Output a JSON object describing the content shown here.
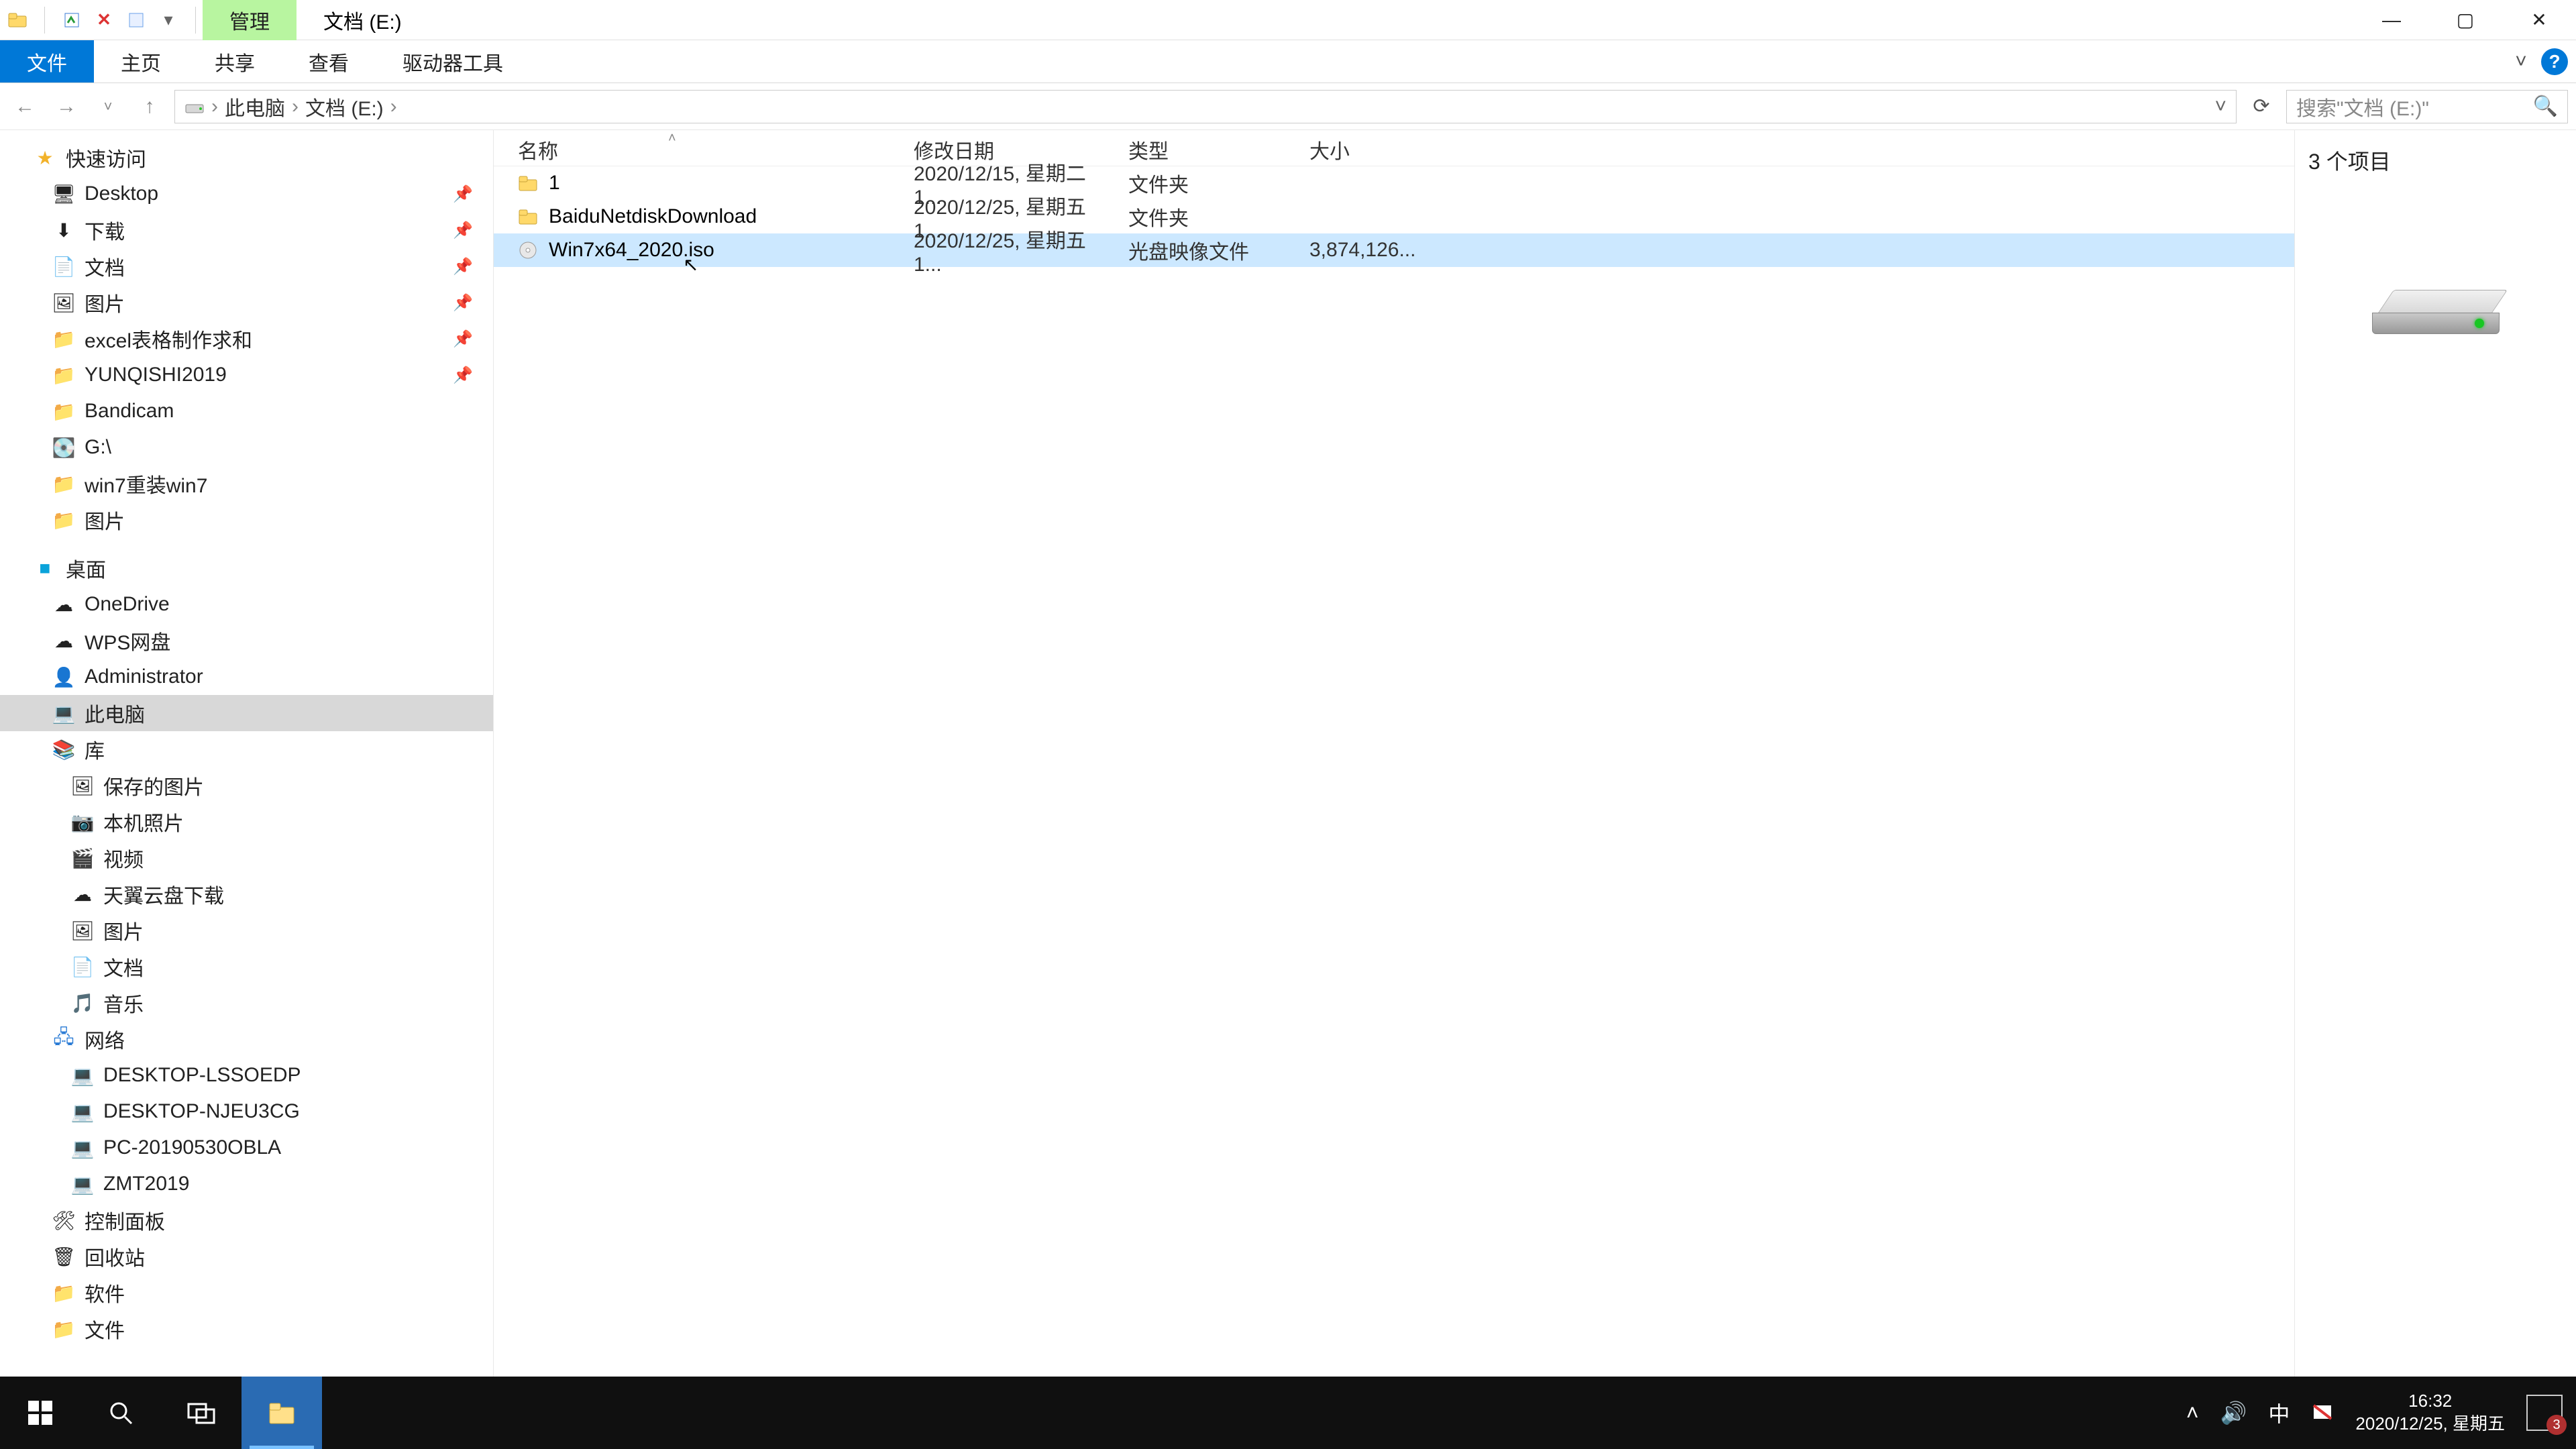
{
  "title": {
    "contextual_tab": "管理",
    "location_label": "文档 (E:)"
  },
  "window_controls": {
    "minimize": "—",
    "maximize": "▢",
    "close": "✕"
  },
  "ribbon": {
    "file": "文件",
    "home": "主页",
    "share": "共享",
    "view": "查看",
    "drive_tools": "驱动器工具"
  },
  "nav": {
    "back": "←",
    "forward": "→",
    "recent": "˅",
    "up": "↑",
    "crumbs": [
      "此电脑",
      "文档 (E:)"
    ],
    "search_placeholder": "搜索\"文档 (E:)\""
  },
  "tree": {
    "quick_access": "快速访问",
    "quick_items": [
      {
        "icon": "🖥",
        "label": "Desktop",
        "pinned": true
      },
      {
        "icon": "⬇",
        "label": "下载",
        "pinned": true
      },
      {
        "icon": "📄",
        "label": "文档",
        "pinned": true
      },
      {
        "icon": "🖼",
        "label": "图片",
        "pinned": true
      },
      {
        "icon": "📁",
        "label": "excel表格制作求和",
        "pinned": true
      },
      {
        "icon": "📁",
        "label": "YUNQISHI2019",
        "pinned": true
      },
      {
        "icon": "📁",
        "label": "Bandicam",
        "pinned": false
      },
      {
        "icon": "💽",
        "label": "G:\\",
        "pinned": false
      },
      {
        "icon": "📁",
        "label": "win7重装win7",
        "pinned": false
      },
      {
        "icon": "📁",
        "label": "图片",
        "pinned": false
      }
    ],
    "desktop": "桌面",
    "desktop_items": [
      {
        "icon": "☁",
        "label": "OneDrive"
      },
      {
        "icon": "☁",
        "label": "WPS网盘"
      },
      {
        "icon": "👤",
        "label": "Administrator"
      },
      {
        "icon": "💻",
        "label": "此电脑",
        "selected": true
      },
      {
        "icon": "📚",
        "label": "库"
      }
    ],
    "library_items": [
      {
        "icon": "🖼",
        "label": "保存的图片"
      },
      {
        "icon": "📷",
        "label": "本机照片"
      },
      {
        "icon": "🎬",
        "label": "视频"
      },
      {
        "icon": "☁",
        "label": "天翼云盘下载"
      },
      {
        "icon": "🖼",
        "label": "图片"
      },
      {
        "icon": "📄",
        "label": "文档"
      },
      {
        "icon": "🎵",
        "label": "音乐"
      }
    ],
    "network": "网络",
    "network_items": [
      {
        "icon": "💻",
        "label": "DESKTOP-LSSOEDP"
      },
      {
        "icon": "💻",
        "label": "DESKTOP-NJEU3CG"
      },
      {
        "icon": "💻",
        "label": "PC-20190530OBLA"
      },
      {
        "icon": "💻",
        "label": "ZMT2019"
      }
    ],
    "control_panel": {
      "icon": "🛠",
      "label": "控制面板"
    },
    "recycle_bin": {
      "icon": "🗑",
      "label": "回收站"
    },
    "extra": [
      {
        "icon": "📁",
        "label": "软件"
      },
      {
        "icon": "📁",
        "label": "文件"
      }
    ]
  },
  "columns": {
    "name": "名称",
    "date": "修改日期",
    "type": "类型",
    "size": "大小"
  },
  "files": [
    {
      "icon": "folder",
      "name": "1",
      "date": "2020/12/15, 星期二 1...",
      "type": "文件夹",
      "size": ""
    },
    {
      "icon": "folder",
      "name": "BaiduNetdiskDownload",
      "date": "2020/12/25, 星期五 1...",
      "type": "文件夹",
      "size": ""
    },
    {
      "icon": "iso",
      "name": "Win7x64_2020.iso",
      "date": "2020/12/25, 星期五 1...",
      "type": "光盘映像文件",
      "size": "3,874,126...",
      "selected": true
    }
  ],
  "preview": {
    "count_label": "3 个项目"
  },
  "status": {
    "text": "3 个项目"
  },
  "taskbar": {
    "time": "16:32",
    "date": "2020/12/25, 星期五",
    "ime": "中",
    "notif_count": "3"
  }
}
